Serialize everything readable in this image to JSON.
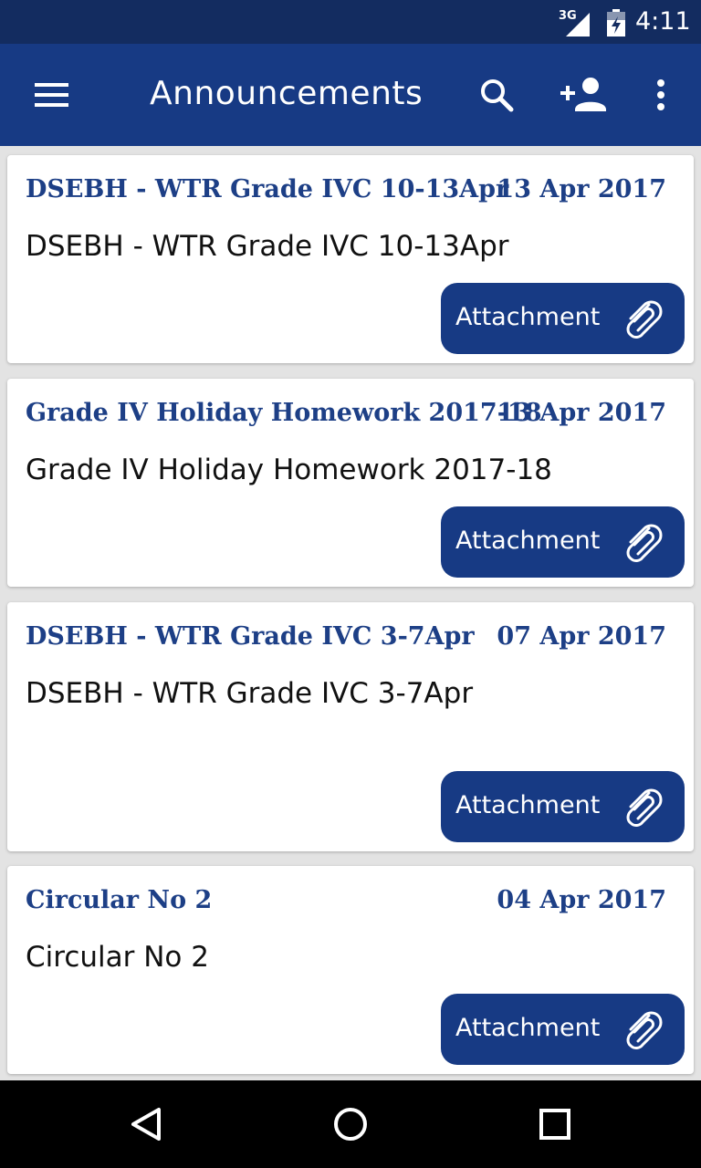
{
  "status_bar": {
    "network": "3G",
    "time": "4:11"
  },
  "app_bar": {
    "title": "Announcements"
  },
  "announcements": [
    {
      "title": "DSEBH - WTR Grade IVC 10-13Apr",
      "date": "13 Apr 2017",
      "body": "DSEBH - WTR Grade IVC 10-13Apr",
      "attachment_label": "Attachment"
    },
    {
      "title": "Grade IV Holiday Homework 2017-18",
      "date": "13 Apr 2017",
      "body": "Grade IV Holiday Homework 2017-18",
      "attachment_label": "Attachment"
    },
    {
      "title": "DSEBH - WTR Grade IVC 3-7Apr",
      "date": "07 Apr 2017",
      "body": "DSEBH - WTR Grade IVC 3-7Apr",
      "attachment_label": "Attachment"
    },
    {
      "title": "Circular No 2",
      "date": "04 Apr 2017",
      "body": "Circular No 2",
      "attachment_label": "Attachment"
    }
  ],
  "icons": {
    "menu": "hamburger-icon",
    "search": "search-icon",
    "add_user": "add-user-icon",
    "more": "more-vert-icon",
    "attachment": "paperclip-icon",
    "nav_back": "back-triangle-icon",
    "nav_home": "home-circle-icon",
    "nav_recents": "recents-square-icon"
  },
  "colors": {
    "status_bar": "#132c60",
    "app_bar": "#173a84",
    "accent_text": "#1d3f86",
    "background": "#e3e3e3"
  }
}
